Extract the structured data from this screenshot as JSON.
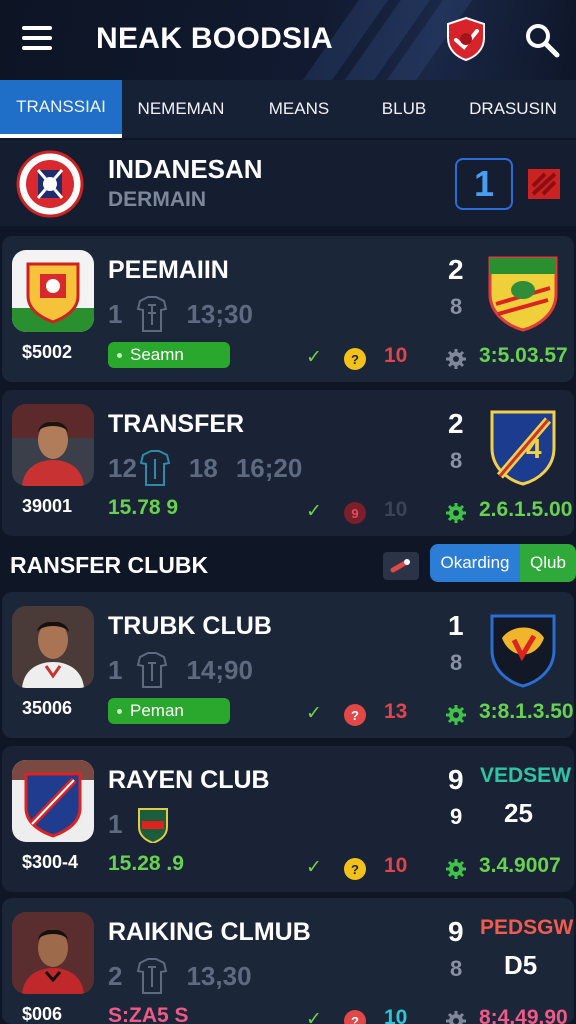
{
  "header": {
    "title": "NEAK BOODSIA",
    "menu_icon": "hamburger-menu-icon",
    "shield_icon": "shield-check-icon",
    "search_icon": "search-icon"
  },
  "tabs": [
    {
      "label": "TRANSSIAI",
      "active": true
    },
    {
      "label": "NEMEMAN",
      "active": false
    },
    {
      "label": "MEANS",
      "active": false
    },
    {
      "label": "BLUB",
      "active": false
    },
    {
      "label": "DRASUSIN",
      "active": false
    }
  ],
  "league": {
    "name": "INDANESAN",
    "subtitle": "DERMAIN",
    "count": "1"
  },
  "cards": [
    {
      "name": "PEEMAIIN",
      "price": "$5002",
      "num": "1",
      "time": "13;30",
      "pill": "Seamn",
      "count": "10",
      "count_color": "#e2444b",
      "coin_color": "#f2c21b",
      "coin": "?",
      "code": "3:5.03.57",
      "rank_top": "2",
      "rank_bot": "8"
    },
    {
      "name": "TRANSFER",
      "price": "39001",
      "num": "12",
      "num2": "18",
      "time": "16;20",
      "odds": "15.78 9",
      "count": "10",
      "count_color": "#3b4457",
      "coin_color": "#7b1f2a",
      "coin": "9",
      "code": "2.6.1.5.00",
      "rank_top": "2",
      "rank_bot": "8"
    },
    {
      "name": "TRUBK CLUB",
      "price": "35006",
      "num": "1",
      "time": "14;90",
      "pill": "Peman",
      "count": "13",
      "count_color": "#e2444b",
      "coin_color": "#e24848",
      "coin": "?",
      "code": "3:8.1.3.50",
      "rank_top": "1",
      "rank_bot": "8"
    },
    {
      "name": "RAYEN CLUB",
      "price": "$300-4",
      "num": "1",
      "odds": "15.28 .9",
      "count": "10",
      "count_color": "#e2444b",
      "coin_color": "#f2c21b",
      "coin": "?",
      "code": "3.4.9007",
      "rank_top": "9",
      "rank_bot": "9",
      "tag": "VEDSEW",
      "tag_color": "#2ec5a4",
      "big": "25"
    },
    {
      "name": "RAIKING CLMUB",
      "price": "$006",
      "num": "2",
      "time": "13,30",
      "odds": "S:ZA5 S",
      "odds_color": "#ee5b87",
      "count": "10",
      "count_color": "#2ec5d6",
      "coin_color": "#e24848",
      "coin": "?",
      "code": "8:4.49.90",
      "code_color": "#ee5b87",
      "rank_top": "9",
      "rank_bot": "8",
      "tag": "PEDSGW",
      "tag_color": "#f25b4d",
      "big": "D5"
    }
  ],
  "section": {
    "title": "RANSFER CLUBK",
    "toggle_a": "Okarding",
    "toggle_b": "Qlub"
  },
  "colors": {
    "accent_blue": "#1f6fc9",
    "green": "#29a82d",
    "background": "#0f1626"
  }
}
